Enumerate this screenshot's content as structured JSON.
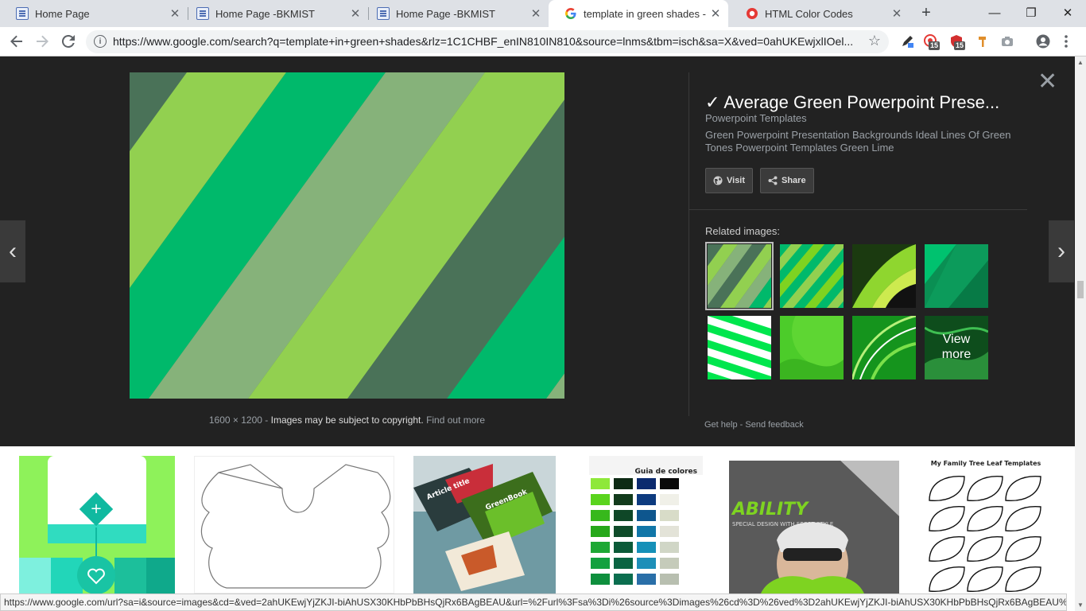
{
  "browser": {
    "tabs": [
      {
        "title": "Home Page",
        "favicon": "document-icon"
      },
      {
        "title": "Home Page -BKMIST",
        "favicon": "document-icon"
      },
      {
        "title": "Home Page -BKMIST",
        "favicon": "document-icon"
      },
      {
        "title": "template in green shades - Go",
        "favicon": "google-icon",
        "active": true
      },
      {
        "title": "HTML Color Codes",
        "favicon": "red-circle-icon"
      }
    ],
    "new_tab_icon": "+",
    "window_controls": {
      "minimize": "—",
      "restore": "❐",
      "close": "✕"
    }
  },
  "toolbar": {
    "url": "https://www.google.com/search?q=template+in+green+shades&rlz=1C1CHBF_enIN810IN810&source=lnms&tbm=isch&sa=X&ved=0ahUKEwjxlIOel...",
    "badge_1": "15",
    "badge_2": "15"
  },
  "preview": {
    "title": "✓ Average Green Powerpoint Prese...",
    "source": "Powerpoint Templates",
    "description": "Green Powerpoint Presentation Backgrounds Ideal Lines Of Green Tones Powerpoint Templates Green Lime",
    "visit_label": "Visit",
    "share_label": "Share",
    "related_label": "Related images:",
    "view_more": [
      "View",
      "more"
    ],
    "caption_size": "1600 × 1200",
    "caption_sep": " - ",
    "caption_copyright": "Images may be subject to copyright.",
    "caption_link": "Find out more",
    "get_help": "Get help",
    "send_feedback": "Send feedback",
    "footer_sep": " - "
  },
  "results": {
    "guia_title": "Guia de colores",
    "family_tree_title": "My Family Tree Leaf Templates",
    "ability_title": "ABILITY",
    "ability_subtitle": "SPECIAL DESIGN WITH SPORT STYLE",
    "magazine_title": "Article title",
    "magazine_sub": "GreenBook"
  },
  "status": {
    "url": "https://www.google.com/url?sa=i&source=images&cd=&ved=2ahUKEwjYjZKJI-biAhUSX30KHbPbBHsQjRx6BAgBEAU&url=%2Furl%3Fsa%3Di%26source%3Dimages%26cd%3D%26ved%3D2ahUKEwjYjZKJI-biAhUSX30KHbPbBHsQjRx6BAgBEAU%26url%..."
  },
  "colors": {
    "stripe_dark": "#4a7258",
    "stripe_lime": "#92d050",
    "stripe_green": "#00b96b",
    "stripe_sage": "#86b27a",
    "panel_bg": "#222222"
  }
}
